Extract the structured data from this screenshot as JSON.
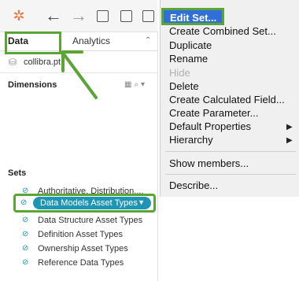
{
  "toolbar": {
    "icons": [
      "tableau-logo-icon",
      "back-arrow-icon",
      "forward-arrow-icon",
      "save-icon",
      "new-datasource-icon",
      "new-sheet-icon"
    ]
  },
  "tabs": {
    "data": "Data",
    "analytics": "Analytics"
  },
  "datasource": {
    "name": "collibra.pt"
  },
  "dimensions": {
    "title": "Dimensions"
  },
  "sets": {
    "title": "Sets",
    "items": [
      "Authoritative, Distribution,...",
      "Data Models Asset Types",
      "Data Structure Asset Types",
      "Definition Asset Types",
      "Ownership Asset Types",
      "Reference Data Types"
    ],
    "selected_index": 1
  },
  "menu": {
    "items": [
      {
        "label": "Edit Set..."
      },
      {
        "label": "Create Combined Set..."
      },
      {
        "label": "Duplicate"
      },
      {
        "label": "Rename"
      },
      {
        "label": "Hide"
      },
      {
        "label": "Delete"
      },
      {
        "label": "Create Calculated Field..."
      },
      {
        "label": "Create Parameter..."
      },
      {
        "label": "Default Properties"
      },
      {
        "label": "Hierarchy"
      },
      {
        "label": "Show members..."
      },
      {
        "label": "Describe..."
      }
    ]
  },
  "colors": {
    "highlight_green": "#5aa536",
    "menu_selected": "#2f6fd7",
    "pill_blue": "#1f95b6"
  }
}
